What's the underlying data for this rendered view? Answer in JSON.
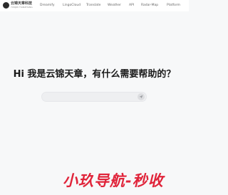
{
  "header": {
    "logo_text": "云锦天章科技",
    "logo_sub": "YUNJIN TIANZHANG",
    "nav_items": [
      {
        "label": "Dreamify"
      },
      {
        "label": "LingoCloud"
      },
      {
        "label": "Translate"
      },
      {
        "label": "Weather"
      },
      {
        "label": "API"
      },
      {
        "label": "Radar-Map"
      },
      {
        "label": "Platform"
      }
    ]
  },
  "hero": {
    "title": "Hi 我是云锦天章，有什么需要帮助的？"
  },
  "search": {
    "placeholder": "",
    "value": ""
  },
  "watermark": {
    "text": "小玖导航-秒收"
  },
  "colors": {
    "accent": "#e0243a",
    "background": "#f7f8f9"
  }
}
